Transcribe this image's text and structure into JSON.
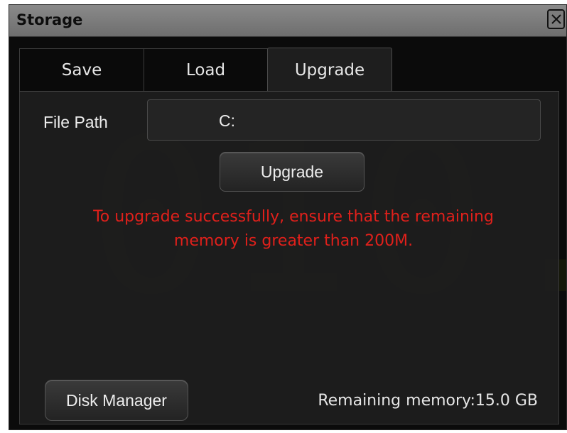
{
  "window": {
    "title": "Storage",
    "close_icon": "close-icon"
  },
  "tabs": [
    {
      "label": "Save",
      "active": false
    },
    {
      "label": "Load",
      "active": false
    },
    {
      "label": "Upgrade",
      "active": true
    }
  ],
  "upgrade_panel": {
    "file_path_label": "File Path",
    "file_path_value": "C:",
    "upgrade_button_label": "Upgrade",
    "warning_line1": "To upgrade successfully, ensure that the remaining",
    "warning_line2": "memory is greater than 200M.",
    "warning_color": "#e0201b",
    "disk_manager_label": "Disk Manager",
    "remaining_memory": "Remaining memory:15.0 GB"
  }
}
